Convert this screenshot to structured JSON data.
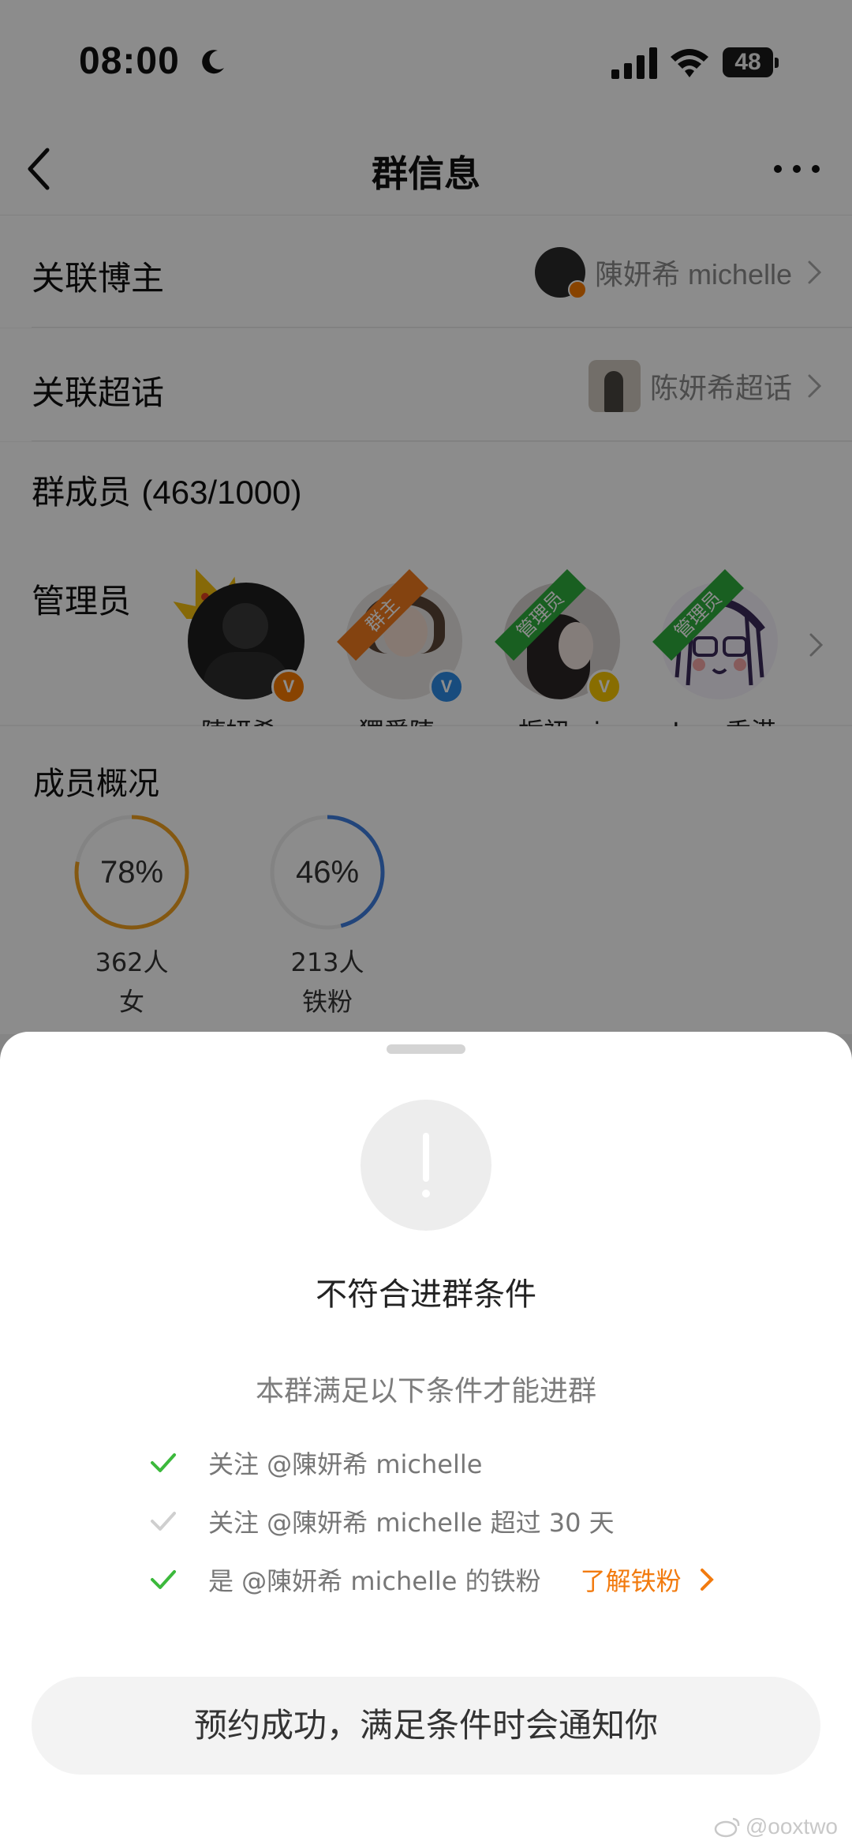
{
  "status_bar": {
    "time": "08:00",
    "battery": "48"
  },
  "navbar": {
    "title": "群信息"
  },
  "linked_blogger": {
    "label": "关联博主",
    "name": "陳妍希 michelle"
  },
  "linked_topic": {
    "label": "关联超话",
    "name": "陈妍希超话"
  },
  "members": {
    "title": "群成员",
    "count": "(463/1000)",
    "admin_label": "管理员",
    "admins": [
      {
        "name": "陳妍希...",
        "role": "",
        "badge_color": "#f77b00"
      },
      {
        "name": "獨愛陳...",
        "role": "群主",
        "badge_color": "#2d8ae6"
      },
      {
        "name": "栀初mic",
        "role": "管理员",
        "badge_color": "#f7c600"
      },
      {
        "name": "Joey香港",
        "role": "管理员",
        "badge_color": ""
      }
    ]
  },
  "overview": {
    "title": "成员概况",
    "stats": [
      {
        "percent": "78%",
        "fraction": 0.78,
        "count": "362人",
        "label": "女",
        "color": "#f0a020"
      },
      {
        "percent": "46%",
        "fraction": 0.46,
        "count": "213人",
        "label": "铁粉",
        "color": "#3f7fe0"
      }
    ]
  },
  "sheet": {
    "title": "不符合进群条件",
    "subtitle": "本群满足以下条件才能进群",
    "conditions": [
      {
        "text": "关注 @陳妍希 michelle",
        "met": true
      },
      {
        "text": "关注 @陳妍希 michelle 超过 30 天",
        "met": false
      },
      {
        "text": "是 @陳妍希 michelle 的铁粉",
        "met": true
      }
    ],
    "learn_link": "了解铁粉",
    "button": "预约成功，满足条件时会通知你"
  },
  "watermark": "@ooxtwo"
}
